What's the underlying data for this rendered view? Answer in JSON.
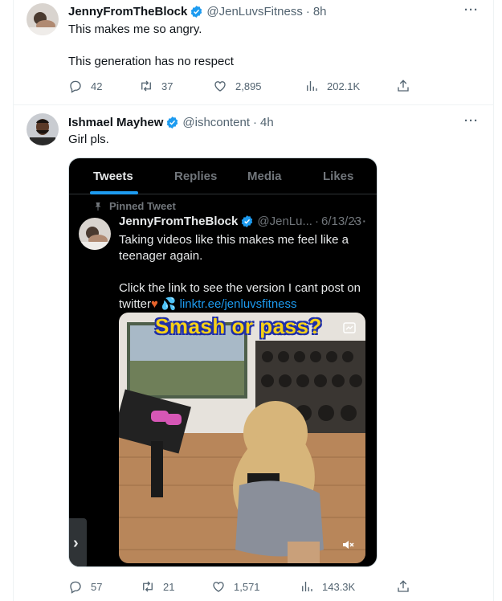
{
  "tweets": [
    {
      "name": "JennyFromTheBlock",
      "handle": "@JenLuvsFitness",
      "time": "8h",
      "text_lines": [
        "This makes me so angry.",
        "This generation has no respect"
      ],
      "replies": "42",
      "retweets": "37",
      "likes": "2,895",
      "views": "202.1K"
    },
    {
      "name": "Ishmael Mayhew",
      "handle": "@ishcontent",
      "time": "4h",
      "text_lines": [
        "Girl pls."
      ],
      "replies": "57",
      "retweets": "21",
      "likes": "1,571",
      "views": "143.3K"
    }
  ],
  "embed": {
    "tabs": [
      "Tweets",
      "Replies",
      "Media",
      "Likes"
    ],
    "active_tab": "Tweets",
    "pinned_label": "Pinned Tweet",
    "name": "JennyFromTheBlock",
    "handle": "@JenLu...",
    "date": "6/13/23",
    "text": {
      "line1": "Taking videos like this makes me feel like a",
      "line2": "teenager again.",
      "line3": "Click the link to see the version I cant post on",
      "line4_prefix": "twitter",
      "link": "linktr.ee/jenluvsfitness"
    },
    "media_caption": "Smash or pass?"
  },
  "icons": {
    "verified": "verified-badge-icon",
    "reply": "reply-icon",
    "retweet": "retweet-icon",
    "like": "heart-icon",
    "views": "views-icon",
    "share": "share-icon",
    "more": "more-icon"
  },
  "colors": {
    "accent": "#1d9bf0",
    "text": "#0f1419",
    "muted": "#536471"
  }
}
